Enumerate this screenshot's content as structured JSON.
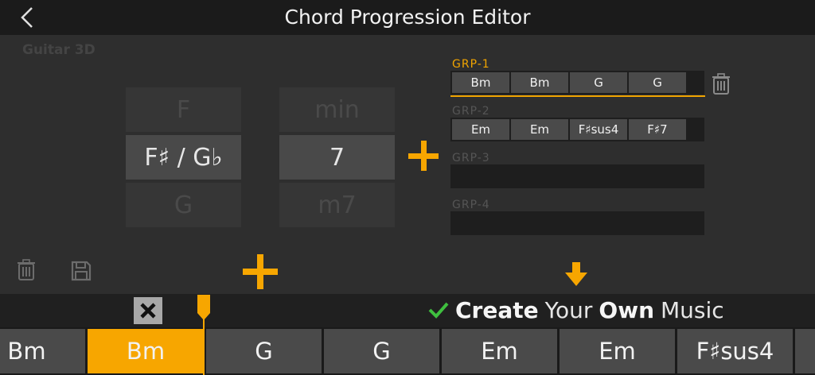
{
  "header": {
    "title": "Chord Progression Editor",
    "back_icon": "chevron-left-icon"
  },
  "instrument": "Guitar 3D",
  "root_picker": [
    "F",
    "F♯ / G♭",
    "G"
  ],
  "type_picker": [
    "min",
    "7",
    "m7"
  ],
  "groups": [
    {
      "label": "GRP-1",
      "chords": [
        "Bm",
        "Bm",
        "G",
        "G"
      ],
      "active": true
    },
    {
      "label": "GRP-2",
      "chords": [
        "Em",
        "Em",
        "F♯sus4",
        "F♯7"
      ],
      "active": false
    },
    {
      "label": "GRP-3",
      "chords": [],
      "active": false
    },
    {
      "label": "GRP-4",
      "chords": [],
      "active": false
    }
  ],
  "tagline": {
    "word1": "Create",
    "word2": "Your",
    "word3": "Own",
    "word4": "Music"
  },
  "timeline": [
    "Bm",
    "Bm",
    "G",
    "G",
    "Em",
    "Em",
    "F♯sus4"
  ],
  "timeline_selected_index": 1,
  "colors": {
    "accent": "#f7a600",
    "check": "#3fbf3f",
    "background": "#2e2e2e",
    "header": "#1b1b1b"
  },
  "icons": [
    "chevron-left-icon",
    "trash-icon",
    "save-icon",
    "plus-icon",
    "arrow-down-icon",
    "check-icon",
    "close-icon",
    "playhead-icon"
  ]
}
